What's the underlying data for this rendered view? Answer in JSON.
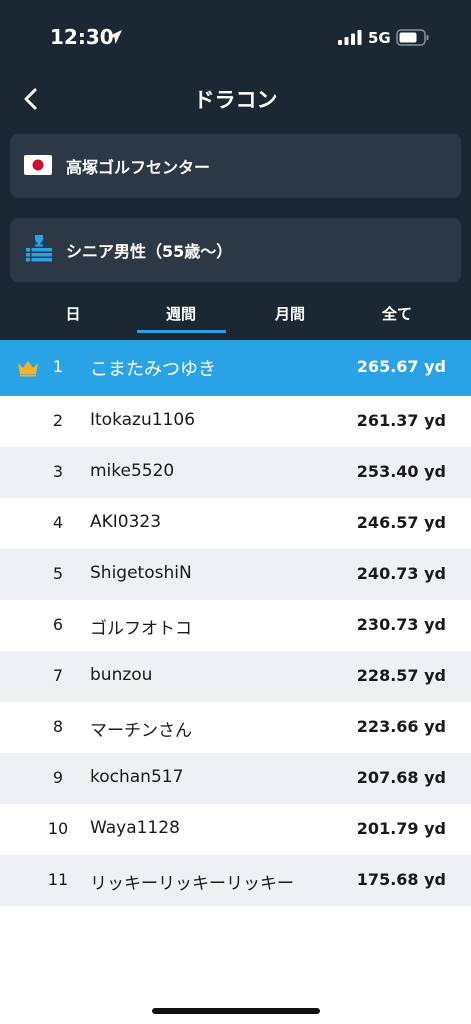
{
  "status_bar": {
    "time": "12:30",
    "network": "5G",
    "location_icon": "location-arrow-icon",
    "signal_icon": "signal-bars-icon",
    "battery_icon": "battery-icon"
  },
  "nav": {
    "title": "ドラコン",
    "back_icon": "chevron-left-icon"
  },
  "venue": {
    "flag_icon": "japan-flag-icon",
    "label": "高塚ゴルフセンター"
  },
  "class_filter": {
    "icon": "ranking-podium-icon",
    "label": "シニア男性（55歳〜）"
  },
  "tabs": [
    {
      "label": "日"
    },
    {
      "label": "週間"
    },
    {
      "label": "月間"
    },
    {
      "label": "全て"
    }
  ],
  "selected_tab": "週間",
  "colors": {
    "header_bg": "#1c2734",
    "card_bg": "#2d3846",
    "accent": "#2aa3e6",
    "crown": "#f5b324",
    "row_alt": "#eef0f3"
  },
  "rankings": [
    {
      "rank": "1",
      "name": "こまたみつゆき",
      "distance": "265.67 yd",
      "crown_icon": "crown-icon"
    },
    {
      "rank": "2",
      "name": "Itokazu1106",
      "distance": "261.37 yd"
    },
    {
      "rank": "3",
      "name": "mike5520",
      "distance": "253.40 yd"
    },
    {
      "rank": "4",
      "name": "AKI0323",
      "distance": "246.57 yd"
    },
    {
      "rank": "5",
      "name": "ShigetoshiN",
      "distance": "240.73 yd"
    },
    {
      "rank": "6",
      "name": "ゴルフオトコ",
      "distance": "230.73 yd"
    },
    {
      "rank": "7",
      "name": "bunzou",
      "distance": "228.57 yd"
    },
    {
      "rank": "8",
      "name": "マーチンさん",
      "distance": "223.66 yd"
    },
    {
      "rank": "9",
      "name": "kochan517",
      "distance": "207.68 yd"
    },
    {
      "rank": "10",
      "name": "Waya1128",
      "distance": "201.79 yd"
    },
    {
      "rank": "11",
      "name": "リッキーリッキーリッキー",
      "distance": "175.68 yd"
    }
  ]
}
